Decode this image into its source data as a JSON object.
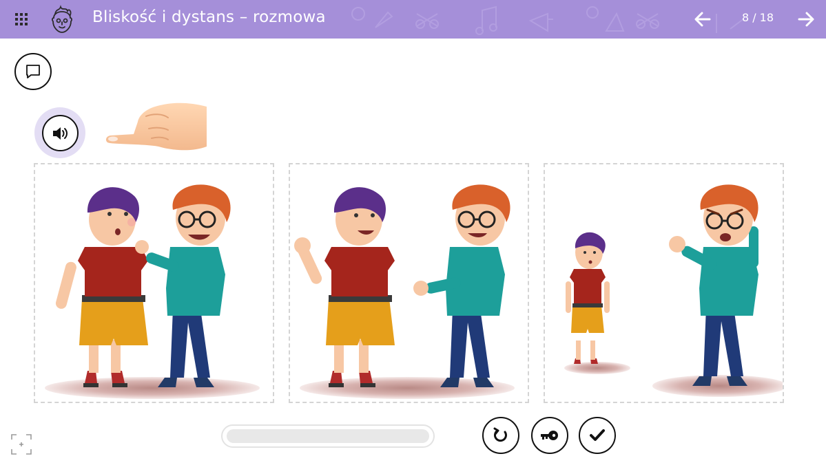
{
  "header": {
    "title": "Bliskość i dystans – rozmowa",
    "page_counter": "8 / 18",
    "menu_icon": "grid-menu-icon",
    "logo_icon": "face-logo-icon",
    "prev_icon": "arrow-left-icon",
    "next_icon": "arrow-right-icon",
    "background_color": "#a58fd9"
  },
  "tools": {
    "comment_icon": "speech-bubble-icon",
    "audio_icon": "speaker-icon",
    "hint_icon": "pointing-hand-icon"
  },
  "panels": [
    {
      "id": "panel-1",
      "scene": "boys-too-close"
    },
    {
      "id": "panel-2",
      "scene": "boys-comfortable-distance"
    },
    {
      "id": "panel-3",
      "scene": "boys-too-far"
    }
  ],
  "progress": {
    "fraction": 0.0
  },
  "controls": {
    "retry_icon": "retry-icon",
    "key_icon": "key-icon",
    "check_icon": "checkmark-icon"
  },
  "colors": {
    "accent": "#a58fd9",
    "halo": "#e3ddf4"
  }
}
